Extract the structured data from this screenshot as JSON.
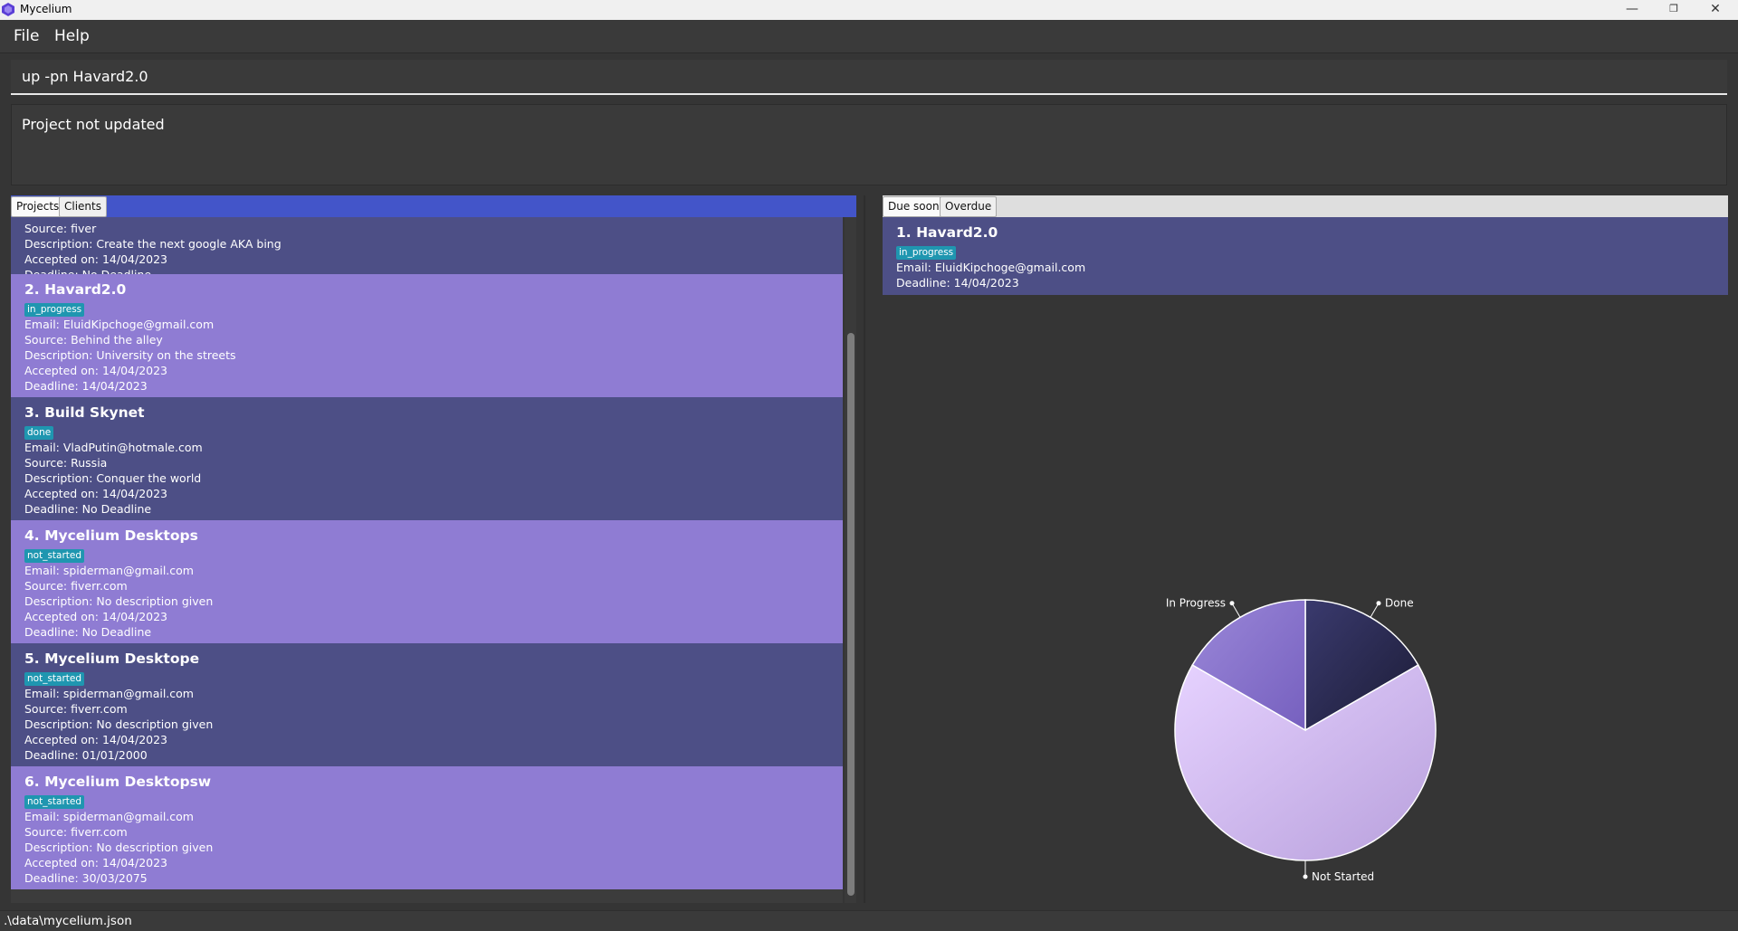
{
  "window": {
    "title": "Mycelium"
  },
  "menu": {
    "file": "File",
    "help": "Help"
  },
  "command": {
    "value": "up -pn Havard2.0"
  },
  "result": {
    "text": "Project not updated"
  },
  "left_tabs": {
    "projects": "Projects",
    "clients": "Clients"
  },
  "partial_card": {
    "source": "Source: fiver",
    "description": "Description: Create the next google AKA bing",
    "accepted": "Accepted on: 14/04/2023",
    "deadline": "Deadline: No Deadline"
  },
  "projects": [
    {
      "title": "2.  Havard2.0",
      "status": "in_progress",
      "email": "Email: EluidKipchoge@gmail.com",
      "source": "Source: Behind the alley",
      "description": "Description: University on the streets",
      "accepted": "Accepted on: 14/04/2023",
      "deadline": "Deadline: 14/04/2023"
    },
    {
      "title": "3.  Build Skynet",
      "status": "done",
      "email": "Email: VladPutin@hotmale.com",
      "source": "Source: Russia",
      "description": "Description: Conquer the world",
      "accepted": "Accepted on: 14/04/2023",
      "deadline": "Deadline: No Deadline"
    },
    {
      "title": "4.  Mycelium Desktops",
      "status": "not_started",
      "email": "Email: spiderman@gmail.com",
      "source": "Source: fiverr.com",
      "description": "Description: No description given",
      "accepted": "Accepted on: 14/04/2023",
      "deadline": "Deadline: No Deadline"
    },
    {
      "title": "5.  Mycelium Desktope",
      "status": "not_started",
      "email": "Email: spiderman@gmail.com",
      "source": "Source: fiverr.com",
      "description": "Description: No description given",
      "accepted": "Accepted on: 14/04/2023",
      "deadline": "Deadline: 01/01/2000"
    },
    {
      "title": "6.  Mycelium Desktopsw",
      "status": "not_started",
      "email": "Email: spiderman@gmail.com",
      "source": "Source: fiverr.com",
      "description": "Description: No description given",
      "accepted": "Accepted on: 14/04/2023",
      "deadline": "Deadline: 30/03/2075"
    }
  ],
  "right_tabs": {
    "due_soon": "Due soon",
    "overdue": "Overdue"
  },
  "due_soon": [
    {
      "title": "1.  Havard2.0",
      "status": "in_progress",
      "email": "Email: EluidKipchoge@gmail.com",
      "deadline": "Deadline: 14/04/2023"
    }
  ],
  "chart_data": {
    "type": "pie",
    "slices": [
      {
        "label": "Done",
        "value": 1
      },
      {
        "label": "Not Started",
        "value": 4
      },
      {
        "label": "In Progress",
        "value": 1
      }
    ]
  },
  "status_bar": {
    "path": ".\\data\\mycelium.json"
  },
  "colors": {
    "accent_tab_bar": "#4355c9",
    "card_dark": "#4d4f86",
    "card_light": "#8f7cd3",
    "tag": "#1f96b0"
  }
}
